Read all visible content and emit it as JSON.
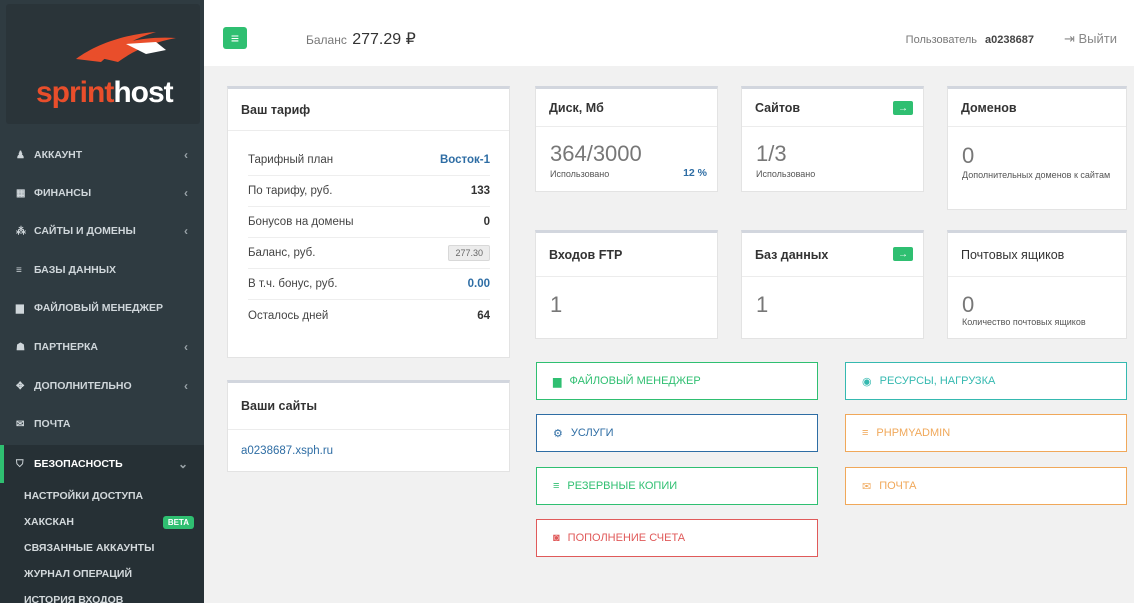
{
  "brand": {
    "logo_text_a": "sprint",
    "logo_text_b": "host"
  },
  "sidebar": {
    "items": [
      {
        "label": "Аккаунт",
        "icon": "user-icon"
      },
      {
        "label": "Финансы",
        "icon": "calculator-icon"
      },
      {
        "label": "Сайты и домены",
        "icon": "sitemap-icon"
      },
      {
        "label": "Базы данных",
        "icon": "database-icon"
      },
      {
        "label": "Файловый менеджер",
        "icon": "file-icon"
      },
      {
        "label": "Партнерка",
        "icon": "users-icon"
      },
      {
        "label": "Дополнительно",
        "icon": "cubes-icon"
      },
      {
        "label": "Почта",
        "icon": "envelope-icon"
      },
      {
        "label": "Безопасность",
        "icon": "shield-icon"
      }
    ],
    "security_subitems": [
      {
        "label": "Настройки доступа"
      },
      {
        "label": "Хакскан",
        "badge": "BETA"
      },
      {
        "label": "Связанные аккаунты"
      },
      {
        "label": "Журнал операций"
      },
      {
        "label": "История входов"
      }
    ]
  },
  "topbar": {
    "balance_label": "Баланс",
    "balance_value": "277.29 ₽",
    "user_label": "Пользователь",
    "username": "a0238687",
    "logout_label": "Выйти"
  },
  "tariff": {
    "title": "Ваш тариф",
    "rows": [
      {
        "label": "Тарифный план",
        "value": "Восток-1"
      },
      {
        "label": "По тарифу, руб.",
        "value": "133"
      },
      {
        "label": "Бонусов на домены",
        "value": "0"
      },
      {
        "label": "Баланс, руб.",
        "value": "277.30"
      },
      {
        "label": "В т.ч. бонус, руб.",
        "value": "0.00"
      },
      {
        "label": "Осталось дней",
        "value": "64"
      }
    ]
  },
  "sites": {
    "title": "Ваши сайты",
    "items": [
      "a0238687.xsph.ru"
    ]
  },
  "stats": {
    "disk": {
      "title": "Диск, Мб",
      "value": "364/3000",
      "sub": "Использовано",
      "percent": "12 %"
    },
    "sites": {
      "title": "Сайтов",
      "value": "1/3",
      "sub": "Использовано"
    },
    "domains": {
      "title": "Доменов",
      "value": "0",
      "sub": "Дополнительных доменов к сайтам"
    },
    "ftp": {
      "title": "Входов FTP",
      "value": "1"
    },
    "db": {
      "title": "Баз данных",
      "value": "1"
    },
    "mail": {
      "title": "Почтовых ящиков",
      "value": "0",
      "sub": "Количество почтовых ящиков"
    }
  },
  "actions": {
    "file_manager": "Файловый менеджер",
    "resources": "Ресурсы, нагрузка",
    "services": "Услуги",
    "phpmyadmin": "phpMyAdmin",
    "backups": "Резервные копии",
    "mail": "Почта",
    "topup": "Пополнение счета"
  },
  "colors": {
    "accent": "#2fbf71",
    "blue": "#2e6da4",
    "teal": "#35b9b0",
    "orange": "#f0a85a",
    "red": "#e05a5a"
  }
}
